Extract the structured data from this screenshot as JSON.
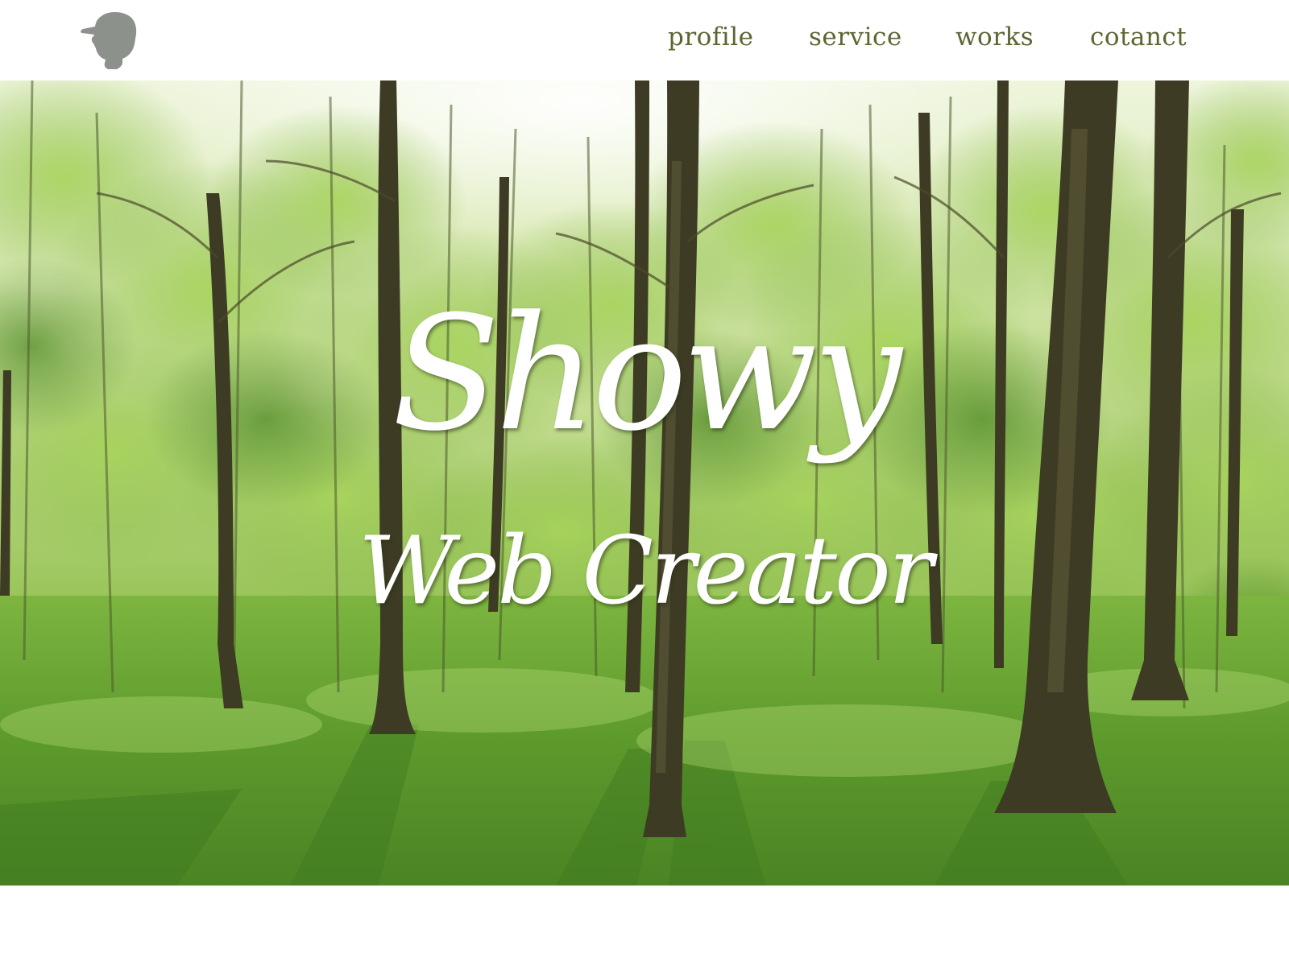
{
  "header": {
    "logo_icon": "silhouette-head-with-cap-icon",
    "nav": [
      {
        "label": "profile"
      },
      {
        "label": "service"
      },
      {
        "label": "works"
      },
      {
        "label": "cotanct"
      }
    ]
  },
  "hero": {
    "title": "Showy",
    "subtitle": "Web Creator",
    "background": "forest-photo"
  },
  "colors": {
    "nav_text": "#5b6633",
    "logo": "#8d918c",
    "hero_text": "#ffffff",
    "foliage": "#8fc24a",
    "grass": "#74b23a",
    "trunk": "#3c3a25"
  }
}
